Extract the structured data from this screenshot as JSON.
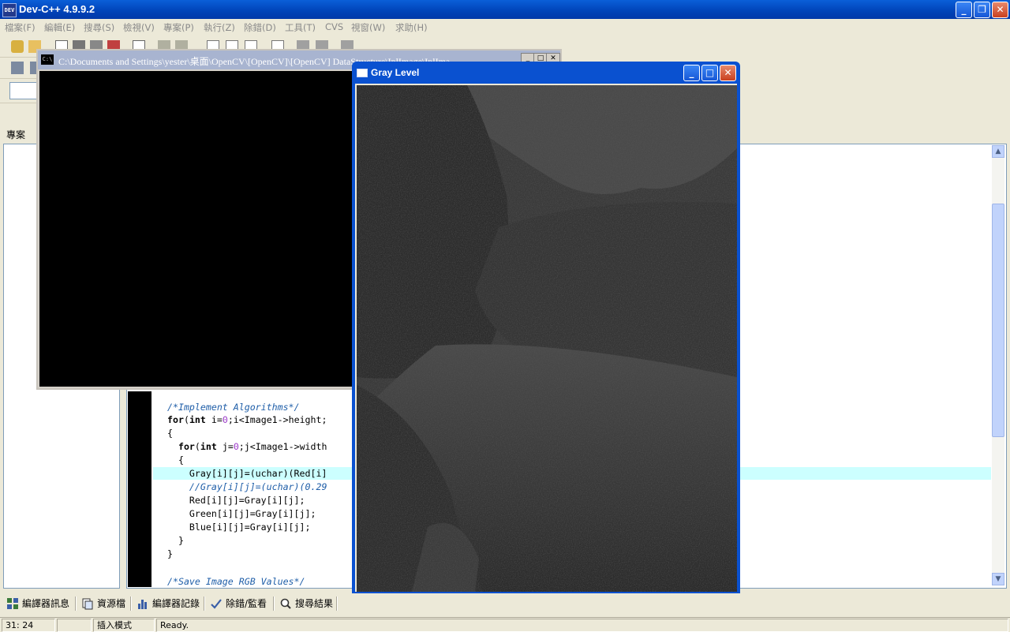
{
  "main_window": {
    "title": "Dev-C++ 4.9.9.2",
    "icon_text": "DEV"
  },
  "menu": [
    "檔案(F)",
    "編輯(E)",
    "搜尋(S)",
    "檢視(V)",
    "專案(P)",
    "執行(Z)",
    "除錯(D)",
    "工具(T)",
    "CVS",
    "視窗(W)",
    "求助(H)"
  ],
  "left_panel": {
    "tab": "專案"
  },
  "console_window": {
    "title": "C:\\Documents and Settings\\yester\\桌面\\OpenCV\\[OpenCV]\\[OpenCV] DataStructure\\IplImage\\IplIma",
    "icon_text": "C:\\"
  },
  "gray_window": {
    "title": "Gray Level"
  },
  "code": {
    "lines": [
      {
        "text": "/*Implement Algorithms*/",
        "type": "comment"
      },
      {
        "text": "for(int i=0;i<Image1->height;",
        "type": "code"
      },
      {
        "text": "{",
        "type": "code"
      },
      {
        "text": "  for(int j=0;j<Image1->width",
        "type": "code"
      },
      {
        "text": "  {",
        "type": "code"
      },
      {
        "text": "    Gray[i][j]=(uchar)(Red[i]",
        "type": "code"
      },
      {
        "text": "    //Gray[i][j]=(uchar)(0.29",
        "type": "comment"
      },
      {
        "text": "    Red[i][j]=Gray[i][j];",
        "type": "code"
      },
      {
        "text": "    Green[i][j]=Gray[i][j];",
        "type": "code"
      },
      {
        "text": "    Blue[i][j]=Gray[i][j];",
        "type": "code"
      },
      {
        "text": "  }",
        "type": "code"
      },
      {
        "text": "}",
        "type": "code"
      },
      {
        "text": "",
        "type": "code"
      },
      {
        "text": "/*Save Image RGB Values*/",
        "type": "comment"
      }
    ]
  },
  "bottom_tabs": [
    "編譯器訊息",
    "資源檔",
    "編譯器記錄",
    "除錯/監看",
    "搜尋結果"
  ],
  "status": {
    "position": "31: 24",
    "mode": "插入模式",
    "message": "Ready."
  }
}
